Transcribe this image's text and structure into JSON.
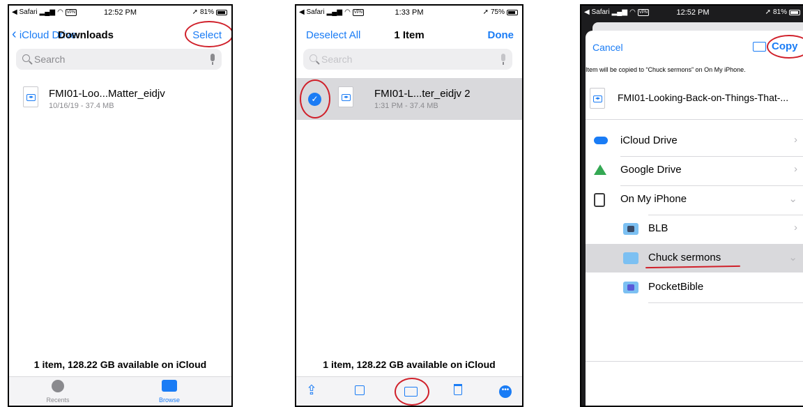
{
  "screen1": {
    "status": {
      "carrier": "◀ Safari",
      "vpn": "VPN",
      "time": "12:52 PM",
      "battery": "81%",
      "battery_level": 0.81
    },
    "nav": {
      "back": "iCloud Drive",
      "title": "Downloads",
      "action": "Select"
    },
    "search": {
      "placeholder": "Search"
    },
    "file": {
      "name": "FMI01-Loo...Matter_eidjv",
      "meta": "10/16/19 - 37.4 MB"
    },
    "footer": "1 item, 128.22 GB available on iCloud",
    "tabs": [
      {
        "label": "Recents"
      },
      {
        "label": "Browse"
      }
    ]
  },
  "screen2": {
    "status": {
      "carrier": "◀ Safari",
      "vpn": "VPN",
      "time": "1:33 PM",
      "battery": "75%",
      "battery_level": 0.75
    },
    "nav": {
      "left": "Deselect All",
      "title": "1 Item",
      "right": "Done"
    },
    "search": {
      "placeholder": "Search"
    },
    "file": {
      "name": "FMI01-L...ter_eidjv 2",
      "meta": "1:31 PM - 37.4 MB"
    },
    "footer": "1 item, 128.22 GB available on iCloud"
  },
  "screen3": {
    "status": {
      "carrier": "◀ Safari",
      "vpn": "VPN",
      "time": "12:52 PM",
      "battery": "81%",
      "battery_level": 0.81
    },
    "nav": {
      "cancel": "Cancel",
      "copy": "Copy"
    },
    "info": "Item will be copied to “Chuck sermons” on On My iPhone.",
    "file_name": "FMI01-Looking-Back-on-Things-That-...",
    "locations": [
      {
        "label": "iCloud Drive"
      },
      {
        "label": "Google Drive"
      },
      {
        "label": "On My iPhone"
      }
    ],
    "folders": [
      {
        "label": "BLB"
      },
      {
        "label": "Chuck sermons"
      },
      {
        "label": "PocketBible"
      }
    ]
  },
  "colors": {
    "accent": "#1a7cf5",
    "annotation": "#d0202a",
    "selected_row": "#d9d9dc"
  }
}
